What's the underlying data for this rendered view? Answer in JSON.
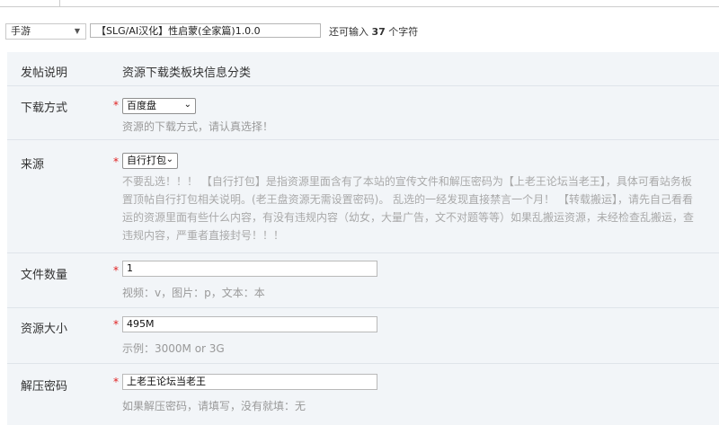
{
  "category": {
    "value": "手游"
  },
  "title_input": {
    "value": "【SLG/AI汉化】性启蒙(全家篇)1.0.0"
  },
  "remaining": {
    "prefix": "还可输入 ",
    "count": "37",
    "suffix": " 个字符"
  },
  "form": {
    "header": {
      "label": "发帖说明",
      "text": "资源下载类板块信息分类"
    },
    "download": {
      "label": "下载方式",
      "star": "*",
      "value": "百度盘",
      "hint": "资源的下载方式，请认真选择！"
    },
    "source": {
      "label": "来源",
      "star": "*",
      "value": "自行打包",
      "warning_lines": [
        "不要乱选！！！ 【自行打包】是指资源里面含有了本站的宣传文件和解压密码为【上老王论坛当老王】，具体可看站务板",
        "置顶帖自行打包相关说明。(老王盘资源无需设置密码)。 乱选的一经发现直接禁言一个月！ 【转载搬运】，请先自己看看",
        "运的资源里面有些什么内容，有没有违规内容（幼女，大量广告，文不对题等等）如果乱搬运资源，未经检查乱搬运，查",
        "违规内容，严重者直接封号！！！"
      ]
    },
    "file_count": {
      "label": "文件数量",
      "star": "*",
      "value": "1",
      "hint": "视频：v，图片：p，文本：本"
    },
    "size": {
      "label": "资源大小",
      "star": "*",
      "value": "495M",
      "hint": "示例：3000M or 3G"
    },
    "password": {
      "label": "解压密码",
      "star": "*",
      "value": "上老王论坛当老王",
      "hint": "如果解压密码，请填写，没有就填：无"
    }
  }
}
